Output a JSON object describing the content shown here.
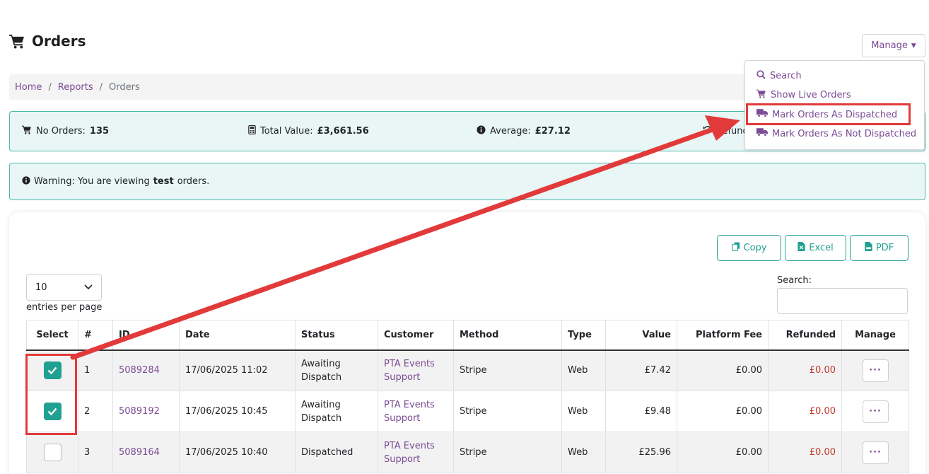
{
  "page": {
    "title": "Orders",
    "icon": "shopping-cart-icon"
  },
  "manage_button": {
    "label": "Manage",
    "icon": "caret-down-icon"
  },
  "breadcrumb": {
    "items": [
      {
        "label": "Home"
      },
      {
        "label": "Reports"
      },
      {
        "label": "Orders"
      }
    ]
  },
  "stats": {
    "no_orders_label": "No Orders:",
    "no_orders_value": "135",
    "total_value_label": "Total Value:",
    "total_value": "£3,661.56",
    "average_label": "Average:",
    "average_value": "£27.12",
    "refunded_label_partial": "Refund"
  },
  "warning": {
    "prefix": "Warning: You are viewing",
    "emphasis": "test",
    "suffix": "orders."
  },
  "export": {
    "copy": "Copy",
    "excel": "Excel",
    "pdf": "PDF"
  },
  "entries": {
    "selected": "10",
    "label": "entries per page"
  },
  "search": {
    "label": "Search:",
    "value": ""
  },
  "table": {
    "headers": {
      "select": "Select",
      "num": "#",
      "id": "ID",
      "date": "Date",
      "status": "Status",
      "customer": "Customer",
      "method": "Method",
      "type": "Type",
      "value": "Value",
      "fee": "Platform Fee",
      "refunded": "Refunded",
      "manage": "Manage"
    },
    "rows": [
      {
        "selected": true,
        "num": "1",
        "id": "5089284",
        "date": "17/06/2025 11:02",
        "status": "Awaiting Dispatch",
        "customer": "PTA Events Support",
        "method": "Stripe",
        "type": "Web",
        "value": "£7.42",
        "fee": "£0.00",
        "refunded": "£0.00",
        "manage": "···"
      },
      {
        "selected": true,
        "num": "2",
        "id": "5089192",
        "date": "17/06/2025 10:45",
        "status": "Awaiting Dispatch",
        "customer": "PTA Events Support",
        "method": "Stripe",
        "type": "Web",
        "value": "£9.48",
        "fee": "£0.00",
        "refunded": "£0.00",
        "manage": "···"
      },
      {
        "selected": false,
        "num": "3",
        "id": "5089164",
        "date": "17/06/2025 10:40",
        "status": "Dispatched",
        "customer": "PTA Events Support",
        "method": "Stripe",
        "type": "Web",
        "value": "£25.96",
        "fee": "£0.00",
        "refunded": "£0.00",
        "manage": "···"
      }
    ]
  },
  "dropdown": {
    "items": [
      {
        "label": "Search",
        "icon": "search-icon"
      },
      {
        "label": "Show Live Orders",
        "icon": "shopping-cart-icon"
      },
      {
        "label": "Mark Orders As Dispatched",
        "icon": "truck-icon"
      },
      {
        "label": "Mark Orders As Not Dispatched",
        "icon": "truck-icon"
      }
    ]
  },
  "colors": {
    "accent_purple": "#7b4b94",
    "accent_teal": "#20a090",
    "panel_bg": "#e8f6f5",
    "annotation_red": "#e23a3a",
    "refund_red": "#c0392b"
  }
}
